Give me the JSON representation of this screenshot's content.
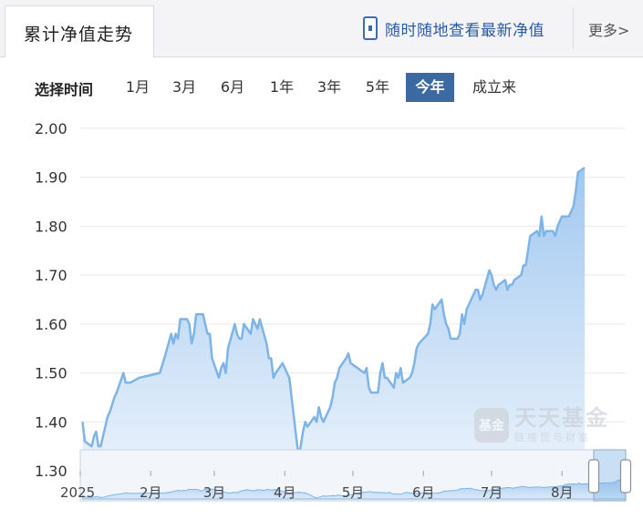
{
  "header": {
    "tab_title": "累计净值走势",
    "promo_text": "随时随地查看最新净值",
    "more_label": "更多>"
  },
  "range_selector": {
    "label": "选择时间",
    "options": [
      "1月",
      "3月",
      "6月",
      "1年",
      "3年",
      "5年",
      "今年",
      "成立来"
    ],
    "active": "今年"
  },
  "watermark": {
    "logo_text": "基金",
    "brand": "天天基金",
    "slogan": "链接您与财富"
  },
  "colors": {
    "line": "#7eb4e6",
    "area_top": "#9cc5ef",
    "area_bottom": "#e6f0fb",
    "grid": "#e6e9ef",
    "active_option": "#3b6aa3"
  },
  "chart_data": {
    "type": "area",
    "ylim": [
      1.3,
      2.0
    ],
    "yticks": [
      "2.00",
      "1.90",
      "1.80",
      "1.70",
      "1.60",
      "1.50",
      "1.40",
      "1.30"
    ],
    "xticks": [
      "2025",
      "2月",
      "3月",
      "4月",
      "5月",
      "6月",
      "7月",
      "8月"
    ],
    "xtick_dates": [
      "2025-01-01",
      "2025-02-01",
      "2025-03-01",
      "2025-04-01",
      "2025-05-01",
      "2025-06-01",
      "2025-07-01",
      "2025-08-01"
    ],
    "x_range": [
      "2025-01-01",
      "2025-08-29"
    ],
    "grid": true,
    "series": [
      {
        "values": [
          [
            "2025-01-02",
            1.4
          ],
          [
            "2025-01-03",
            1.36
          ],
          [
            "2025-01-06",
            1.35
          ],
          [
            "2025-01-07",
            1.37
          ],
          [
            "2025-01-08",
            1.38
          ],
          [
            "2025-01-09",
            1.35
          ],
          [
            "2025-01-10",
            1.35
          ],
          [
            "2025-01-13",
            1.41
          ],
          [
            "2025-01-14",
            1.42
          ],
          [
            "2025-01-16",
            1.45
          ],
          [
            "2025-01-17",
            1.46
          ],
          [
            "2025-01-20",
            1.5
          ],
          [
            "2025-01-21",
            1.48
          ],
          [
            "2025-01-23",
            1.48
          ],
          [
            "2025-01-27",
            1.49
          ],
          [
            "2025-02-05",
            1.5
          ],
          [
            "2025-02-07",
            1.53
          ],
          [
            "2025-02-10",
            1.58
          ],
          [
            "2025-02-11",
            1.56
          ],
          [
            "2025-02-12",
            1.58
          ],
          [
            "2025-02-13",
            1.57
          ],
          [
            "2025-02-14",
            1.61
          ],
          [
            "2025-02-17",
            1.61
          ],
          [
            "2025-02-18",
            1.6
          ],
          [
            "2025-02-19",
            1.56
          ],
          [
            "2025-02-20",
            1.58
          ],
          [
            "2025-02-21",
            1.62
          ],
          [
            "2025-02-24",
            1.62
          ],
          [
            "2025-02-25",
            1.6
          ],
          [
            "2025-02-26",
            1.58
          ],
          [
            "2025-02-27",
            1.58
          ],
          [
            "2025-02-28",
            1.53
          ],
          [
            "2025-03-03",
            1.49
          ],
          [
            "2025-03-04",
            1.51
          ],
          [
            "2025-03-05",
            1.52
          ],
          [
            "2025-03-06",
            1.5
          ],
          [
            "2025-03-07",
            1.55
          ],
          [
            "2025-03-10",
            1.6
          ],
          [
            "2025-03-11",
            1.58
          ],
          [
            "2025-03-12",
            1.57
          ],
          [
            "2025-03-13",
            1.57
          ],
          [
            "2025-03-14",
            1.6
          ],
          [
            "2025-03-17",
            1.58
          ],
          [
            "2025-03-18",
            1.61
          ],
          [
            "2025-03-19",
            1.6
          ],
          [
            "2025-03-20",
            1.59
          ],
          [
            "2025-03-21",
            1.61
          ],
          [
            "2025-03-24",
            1.56
          ],
          [
            "2025-03-25",
            1.53
          ],
          [
            "2025-03-26",
            1.53
          ],
          [
            "2025-03-27",
            1.49
          ],
          [
            "2025-03-28",
            1.5
          ],
          [
            "2025-03-31",
            1.52
          ],
          [
            "2025-04-01",
            1.51
          ],
          [
            "2025-04-02",
            1.5
          ],
          [
            "2025-04-03",
            1.49
          ],
          [
            "2025-04-07",
            1.33
          ],
          [
            "2025-04-08",
            1.35
          ],
          [
            "2025-04-09",
            1.38
          ],
          [
            "2025-04-10",
            1.4
          ],
          [
            "2025-04-11",
            1.39
          ],
          [
            "2025-04-14",
            1.41
          ],
          [
            "2025-04-15",
            1.4
          ],
          [
            "2025-04-16",
            1.43
          ],
          [
            "2025-04-17",
            1.41
          ],
          [
            "2025-04-18",
            1.4
          ],
          [
            "2025-04-21",
            1.43
          ],
          [
            "2025-04-22",
            1.45
          ],
          [
            "2025-04-23",
            1.48
          ],
          [
            "2025-04-24",
            1.49
          ],
          [
            "2025-04-25",
            1.51
          ],
          [
            "2025-04-28",
            1.53
          ],
          [
            "2025-04-29",
            1.54
          ],
          [
            "2025-04-30",
            1.52
          ],
          [
            "2025-05-06",
            1.5
          ],
          [
            "2025-05-07",
            1.51
          ],
          [
            "2025-05-08",
            1.47
          ],
          [
            "2025-05-09",
            1.46
          ],
          [
            "2025-05-12",
            1.46
          ],
          [
            "2025-05-13",
            1.5
          ],
          [
            "2025-05-14",
            1.52
          ],
          [
            "2025-05-15",
            1.49
          ],
          [
            "2025-05-16",
            1.49
          ],
          [
            "2025-05-19",
            1.47
          ],
          [
            "2025-05-20",
            1.5
          ],
          [
            "2025-05-21",
            1.49
          ],
          [
            "2025-05-22",
            1.51
          ],
          [
            "2025-05-23",
            1.48
          ],
          [
            "2025-05-26",
            1.49
          ],
          [
            "2025-05-27",
            1.5
          ],
          [
            "2025-05-28",
            1.52
          ],
          [
            "2025-05-29",
            1.55
          ],
          [
            "2025-05-30",
            1.56
          ],
          [
            "2025-06-03",
            1.58
          ],
          [
            "2025-06-04",
            1.6
          ],
          [
            "2025-06-05",
            1.64
          ],
          [
            "2025-06-06",
            1.63
          ],
          [
            "2025-06-09",
            1.65
          ],
          [
            "2025-06-10",
            1.62
          ],
          [
            "2025-06-11",
            1.6
          ],
          [
            "2025-06-12",
            1.59
          ],
          [
            "2025-06-13",
            1.57
          ],
          [
            "2025-06-16",
            1.57
          ],
          [
            "2025-06-17",
            1.58
          ],
          [
            "2025-06-18",
            1.62
          ],
          [
            "2025-06-19",
            1.6
          ],
          [
            "2025-06-20",
            1.63
          ],
          [
            "2025-06-23",
            1.66
          ],
          [
            "2025-06-24",
            1.67
          ],
          [
            "2025-06-25",
            1.67
          ],
          [
            "2025-06-26",
            1.65
          ],
          [
            "2025-06-27",
            1.66
          ],
          [
            "2025-06-30",
            1.71
          ],
          [
            "2025-07-01",
            1.7
          ],
          [
            "2025-07-02",
            1.68
          ],
          [
            "2025-07-03",
            1.67
          ],
          [
            "2025-07-04",
            1.68
          ],
          [
            "2025-07-07",
            1.69
          ],
          [
            "2025-07-08",
            1.67
          ],
          [
            "2025-07-09",
            1.68
          ],
          [
            "2025-07-10",
            1.68
          ],
          [
            "2025-07-11",
            1.69
          ],
          [
            "2025-07-14",
            1.7
          ],
          [
            "2025-07-15",
            1.72
          ],
          [
            "2025-07-16",
            1.72
          ],
          [
            "2025-07-17",
            1.75
          ],
          [
            "2025-07-18",
            1.78
          ],
          [
            "2025-07-21",
            1.79
          ],
          [
            "2025-07-22",
            1.78
          ],
          [
            "2025-07-23",
            1.82
          ],
          [
            "2025-07-24",
            1.78
          ],
          [
            "2025-07-25",
            1.79
          ],
          [
            "2025-07-28",
            1.79
          ],
          [
            "2025-07-29",
            1.78
          ],
          [
            "2025-07-30",
            1.8
          ],
          [
            "2025-07-31",
            1.81
          ],
          [
            "2025-08-01",
            1.82
          ],
          [
            "2025-08-04",
            1.82
          ],
          [
            "2025-08-05",
            1.83
          ],
          [
            "2025-08-06",
            1.84
          ],
          [
            "2025-08-07",
            1.87
          ],
          [
            "2025-08-08",
            1.91
          ],
          [
            "2025-08-11",
            1.92
          ]
        ]
      }
    ],
    "navigator": {
      "x_range": [
        "2025-01-01",
        "2025-08-11"
      ],
      "selected_range": [
        "2025-07-29",
        "2025-08-11"
      ]
    }
  }
}
